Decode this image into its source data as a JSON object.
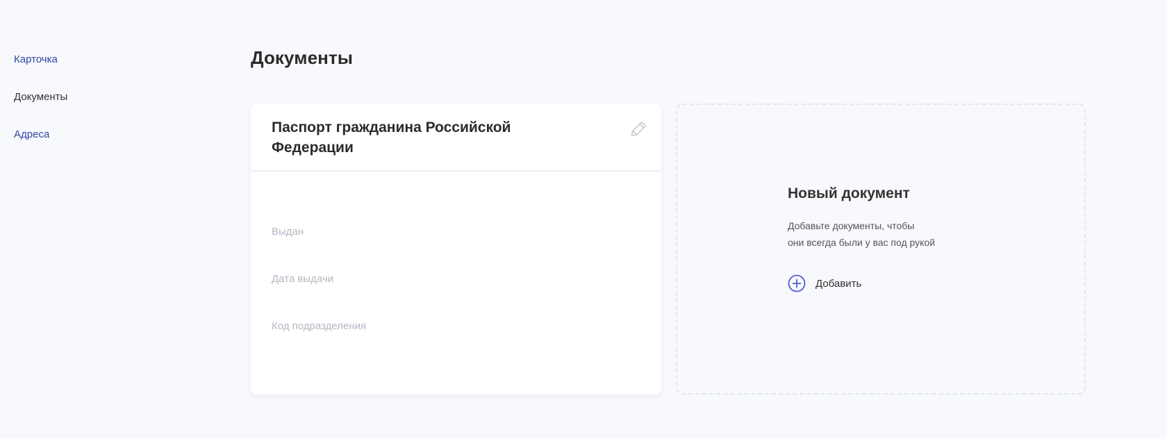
{
  "sidebar": {
    "items": [
      {
        "label": "Карточка"
      },
      {
        "label": "Документы"
      },
      {
        "label": "Адреса"
      }
    ]
  },
  "main": {
    "title": "Документы",
    "document_card": {
      "title": "Паспорт гражданина Российской Федерации",
      "edit_icon": "pencil-icon",
      "fields": [
        {
          "label": "Выдан",
          "value": ""
        },
        {
          "label": "Дата выдачи",
          "value": ""
        },
        {
          "label": "Код подразделения",
          "value": ""
        }
      ]
    },
    "new_document": {
      "title": "Новый документ",
      "description_line1": "Добавьте документы, чтобы",
      "description_line2": "они всегда были у вас под рукой",
      "add_label": "Добавить",
      "add_icon": "plus-circle-icon"
    }
  },
  "colors": {
    "background": "#f8f9fd",
    "link": "#2f45a6",
    "accent": "#4a5ec8",
    "muted_label": "#b4b8c4"
  }
}
